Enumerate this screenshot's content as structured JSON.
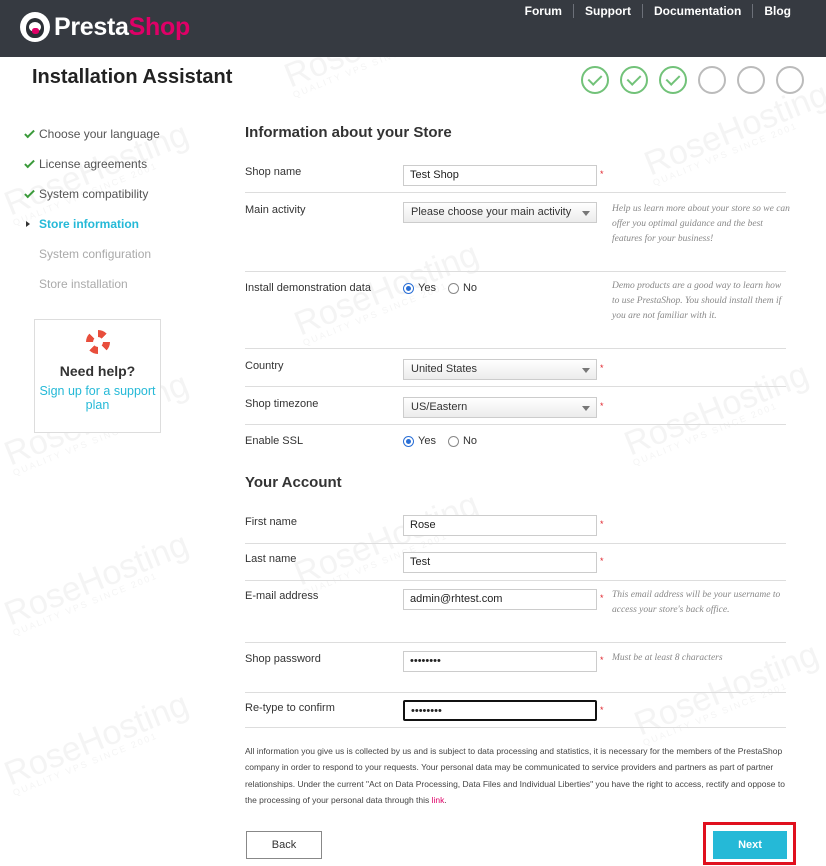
{
  "header": {
    "brand_part1": "Presta",
    "brand_part2": "Shop",
    "nav": [
      "Forum",
      "Support",
      "Documentation",
      "Blog"
    ]
  },
  "page_title": "Installation Assistant",
  "progress": {
    "completed_steps": 3,
    "total_steps": 6
  },
  "sidebar": {
    "items": [
      {
        "label": "Choose your language",
        "state": "done"
      },
      {
        "label": "License agreements",
        "state": "done"
      },
      {
        "label": "System compatibility",
        "state": "done"
      },
      {
        "label": "Store information",
        "state": "active"
      },
      {
        "label": "System configuration",
        "state": "pending"
      },
      {
        "label": "Store installation",
        "state": "pending"
      }
    ],
    "help": {
      "title": "Need help?",
      "link": "Sign up for a support plan"
    }
  },
  "store_section": {
    "title": "Information about your Store",
    "shop_name": {
      "label": "Shop name",
      "value": "Test Shop"
    },
    "main_activity": {
      "label": "Main activity",
      "value": "Please choose your main activity",
      "hint": "Help us learn more about your store so we can offer you optimal guidance and the best features for your business!"
    },
    "demo_data": {
      "label": "Install demonstration data",
      "yes": "Yes",
      "no": "No",
      "selected": "Yes",
      "hint": "Demo products are a good way to learn how to use PrestaShop. You should install them if you are not familiar with it."
    },
    "country": {
      "label": "Country",
      "value": "United States"
    },
    "timezone": {
      "label": "Shop timezone",
      "value": "US/Eastern"
    },
    "ssl": {
      "label": "Enable SSL",
      "yes": "Yes",
      "no": "No",
      "selected": "Yes"
    }
  },
  "account_section": {
    "title": "Your Account",
    "first_name": {
      "label": "First name",
      "value": "Rose"
    },
    "last_name": {
      "label": "Last name",
      "value": "Test"
    },
    "email": {
      "label": "E-mail address",
      "value": "admin@rhtest.com",
      "hint": "This email address will be your username to access your store's back office."
    },
    "password": {
      "label": "Shop password",
      "value": "••••••••",
      "hint": "Must be at least 8 characters"
    },
    "confirm": {
      "label": "Re-type to confirm",
      "value": "••••••••"
    }
  },
  "required_mark": "*",
  "privacy_text": "All information you give us is collected by us and is subject to data processing and statistics, it is necessary for the members of the PrestaShop company in order to respond to your requests. Your personal data may be communicated to service providers and partners as part of partner relationships. Under the current \"Act on Data Processing, Data Files and Individual Liberties\" you have the right to access, rectify and oppose to the processing of your personal data through this ",
  "privacy_link": "link",
  "privacy_end": ".",
  "buttons": {
    "back": "Back",
    "next": "Next"
  },
  "watermark": {
    "brand": "RoseHosting",
    "tagline": "QUALITY VPS SINCE 2001"
  },
  "colors": {
    "header_bg": "#363a41",
    "accent": "#25b9d7",
    "brand_pink": "#df0067",
    "step_done": "#72c279",
    "highlight_frame": "#e0101e"
  }
}
